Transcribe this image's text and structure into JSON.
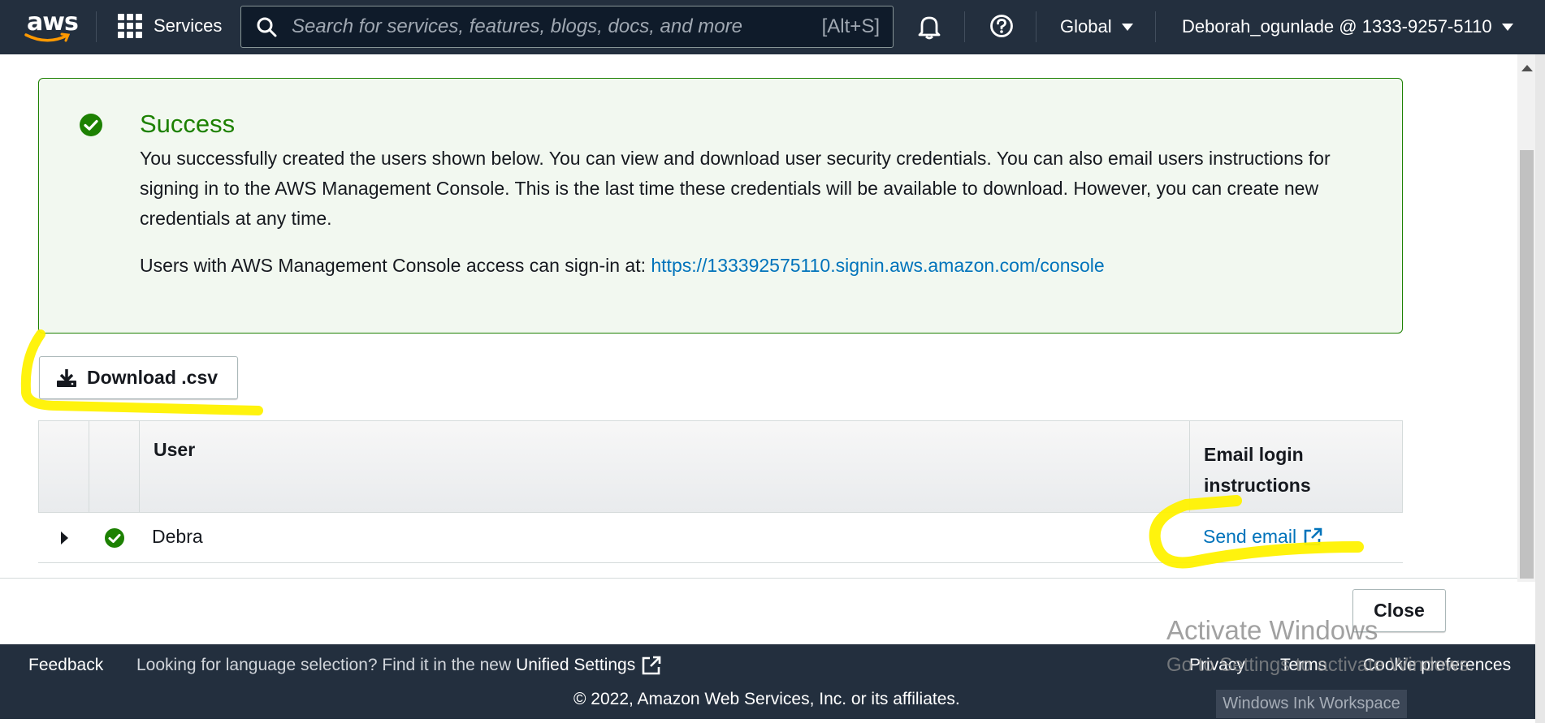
{
  "topnav": {
    "logo_text": "aws",
    "services_label": "Services",
    "search_placeholder": "Search for services, features, blogs, docs, and more",
    "search_shortcut": "[Alt+S]",
    "region_label": "Global",
    "account_label": "Deborah_ogunlade @ 1333-9257-5110"
  },
  "alert": {
    "title": "Success",
    "body": "You successfully created the users shown below. You can view and download user security credentials. You can also email users instructions for signing in to the AWS Management Console. This is the last time these credentials will be available to download. However, you can create new credentials at any time.",
    "signin_prefix": "Users with AWS Management Console access can sign-in at:",
    "signin_url": "https://133392575110.signin.aws.amazon.com/console",
    "status_color": "#1d8102"
  },
  "download_button": {
    "label": "Download .csv"
  },
  "table": {
    "headers": {
      "user": "User",
      "email": "Email login instructions"
    },
    "rows": [
      {
        "user": "Debra",
        "action": "Send email"
      }
    ]
  },
  "close_button": {
    "label": "Close"
  },
  "footer": {
    "feedback": "Feedback",
    "lang_text": "Looking for language selection? Find it in the new",
    "lang_link": "Unified Settings",
    "privacy": "Privacy",
    "terms": "Terms",
    "cookie": "Cookie preferences",
    "copyright": "© 2022, Amazon Web Services, Inc. or its affiliates."
  },
  "windows_overlay": {
    "activate_title": "Activate Windows",
    "activate_sub": "Go to Settings to activate Windows.",
    "ink_workspace": "Windows Ink Workspace"
  },
  "colors": {
    "nav_bg": "#232f3e",
    "link": "#0073bb",
    "highlight": "#fff200"
  }
}
